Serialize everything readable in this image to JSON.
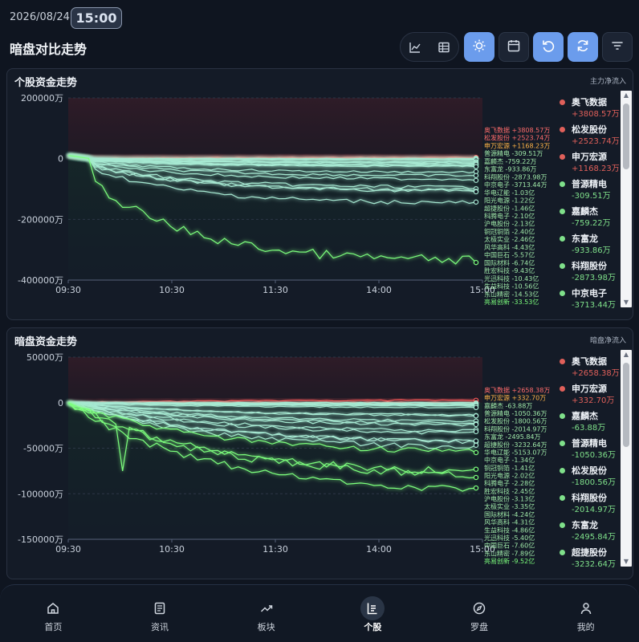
{
  "header": {
    "date": "2026/08/24",
    "time": "15:00",
    "title": "暗盘对比走势"
  },
  "toolbar": {
    "icons": [
      "line-chart-icon",
      "table-icon",
      "sun-icon",
      "calendar-icon",
      "undo-icon",
      "refresh-icon",
      "filter-icon"
    ]
  },
  "colors": {
    "red": "#e0605a",
    "green": "#7fe08a",
    "blue": "#6b9cec",
    "bg": "#0f1520"
  },
  "panel1": {
    "title": "个股资金走势",
    "subtitle": "主力净流入",
    "legend": [
      {
        "name": "奥飞数据",
        "value": "+3808.57万",
        "color": "#e0605a"
      },
      {
        "name": "松发股份",
        "value": "+2523.74万",
        "color": "#e0605a"
      },
      {
        "name": "申万宏源",
        "value": "+1168.23万",
        "color": "#e0605a"
      },
      {
        "name": "普源精电",
        "value": "-309.51万",
        "color": "#7fe08a"
      },
      {
        "name": "嘉麟杰",
        "value": "-759.22万",
        "color": "#7fe08a"
      },
      {
        "name": "东富龙",
        "value": "-933.86万",
        "color": "#7fe08a"
      },
      {
        "name": "科翔股份",
        "value": "-2873.98万",
        "color": "#7fe08a"
      },
      {
        "name": "中京电子",
        "value": "-3713.44万",
        "color": "#7fe08a"
      }
    ]
  },
  "panel2": {
    "title": "暗盘资金走势",
    "subtitle": "暗盘净流入",
    "legend": [
      {
        "name": "奥飞数据",
        "value": "+2658.38万",
        "color": "#e0605a"
      },
      {
        "name": "申万宏源",
        "value": "+332.70万",
        "color": "#e0605a"
      },
      {
        "name": "嘉麟杰",
        "value": "-63.88万",
        "color": "#7fe08a"
      },
      {
        "name": "普源精电",
        "value": "-1050.36万",
        "color": "#7fe08a"
      },
      {
        "name": "松发股份",
        "value": "-1800.56万",
        "color": "#7fe08a"
      },
      {
        "name": "科翔股份",
        "value": "-2014.97万",
        "color": "#7fe08a"
      },
      {
        "name": "东富龙",
        "value": "-2495.84万",
        "color": "#7fe08a"
      },
      {
        "name": "超捷股份",
        "value": "-3232.64万",
        "color": "#7fe08a"
      }
    ]
  },
  "chart_data": [
    {
      "type": "line",
      "title": "个股资金走势",
      "x_ticks": [
        "09:30",
        "10:30",
        "11:30",
        "14:00",
        "15:00"
      ],
      "y_ticks": [
        "200000万",
        "0",
        "-200000万",
        "-400000万"
      ],
      "ylim": [
        -400000,
        200000
      ],
      "unit": "万",
      "series_labels": [
        {
          "text": "奥飞数据 +3808.57万",
          "value": 3808.57,
          "color": "#ff6b6b"
        },
        {
          "text": "松发股份 +2523.74万",
          "value": 2523.74,
          "color": "#ff6b6b"
        },
        {
          "text": "申万宏源 +1168.23万",
          "value": 1168.23,
          "color": "#ffb347"
        },
        {
          "text": "普源精电 -309.51万",
          "value": -309.51,
          "color": "#9fe8a8"
        },
        {
          "text": "嘉麟杰 -759.22万",
          "value": -759.22,
          "color": "#9fe8a8"
        },
        {
          "text": "东富龙 -933.86万",
          "value": -933.86,
          "color": "#9fe8a8"
        },
        {
          "text": "科翔股份 -2873.98万",
          "value": -2873.98,
          "color": "#9fe8a8"
        },
        {
          "text": "中京电子 -3713.44万",
          "value": -3713.44,
          "color": "#9fe8a8"
        },
        {
          "text": "华电辽能 -1.03亿",
          "value": -10300,
          "color": "#9fe8a8"
        },
        {
          "text": "阳光电源 -1.22亿",
          "value": -12200,
          "color": "#9fe8a8"
        },
        {
          "text": "超捷股份 -1.46亿",
          "value": -14600,
          "color": "#9fe8a8"
        },
        {
          "text": "科腾电子 -2.10亿",
          "value": -21000,
          "color": "#9fe8a8"
        },
        {
          "text": "沪电股份 -2.13亿",
          "value": -21300,
          "color": "#9fe8a8"
        },
        {
          "text": "铜冠铜箔 -2.40亿",
          "value": -24000,
          "color": "#9fe8a8"
        },
        {
          "text": "太极实业 -2.46亿",
          "value": -24600,
          "color": "#9fe8a8"
        },
        {
          "text": "风华高科 -4.43亿",
          "value": -44300,
          "color": "#9fe8a8"
        },
        {
          "text": "中国巨石 -5.57亿",
          "value": -55700,
          "color": "#9fe8a8"
        },
        {
          "text": "国际材料 -6.74亿",
          "value": -67400,
          "color": "#9fe8a8"
        },
        {
          "text": "胜宏科技 -9.43亿",
          "value": -94300,
          "color": "#9fe8a8"
        },
        {
          "text": "光迅科技 -10.43亿",
          "value": -104300,
          "color": "#9fe8a8"
        },
        {
          "text": "生益科技 -10.56亿",
          "value": -105600,
          "color": "#9fe8a8"
        },
        {
          "text": "东山精密 -14.53亿",
          "value": -145300,
          "color": "#9fe8a8"
        },
        {
          "text": "亮易创新 -33.53亿",
          "value": -335300,
          "color": "#7dff7d"
        }
      ]
    },
    {
      "type": "line",
      "title": "暗盘资金走势",
      "x_ticks": [
        "09:30",
        "10:30",
        "11:30",
        "14:00",
        "15:00"
      ],
      "y_ticks": [
        "50000万",
        "0",
        "-50000万",
        "-100000万",
        "-150000万"
      ],
      "ylim": [
        -150000,
        50000
      ],
      "unit": "万",
      "series_labels": [
        {
          "text": "奥飞数据 +2658.38万",
          "value": 2658.38,
          "color": "#ff6b6b"
        },
        {
          "text": "申万宏源 +332.70万",
          "value": 332.7,
          "color": "#ffb347"
        },
        {
          "text": "嘉麟杰 -63.88万",
          "value": -63.88,
          "color": "#9fe8a8"
        },
        {
          "text": "普源精电 -1050.36万",
          "value": -1050.36,
          "color": "#9fe8a8"
        },
        {
          "text": "松发股份 -1800.56万",
          "value": -1800.56,
          "color": "#9fe8a8"
        },
        {
          "text": "科翔股份 -2014.97万",
          "value": -2014.97,
          "color": "#9fe8a8"
        },
        {
          "text": "东富龙 -2495.84万",
          "value": -2495.84,
          "color": "#9fe8a8"
        },
        {
          "text": "超捷股份 -3232.64万",
          "value": -3232.64,
          "color": "#9fe8a8"
        },
        {
          "text": "华电辽能 -5153.07万",
          "value": -5153.07,
          "color": "#9fe8a8"
        },
        {
          "text": "中京电子 -1.34亿",
          "value": -13400,
          "color": "#9fe8a8"
        },
        {
          "text": "铜冠铜箔 -1.41亿",
          "value": -14100,
          "color": "#9fe8a8"
        },
        {
          "text": "阳光电源 -2.02亿",
          "value": -20200,
          "color": "#9fe8a8"
        },
        {
          "text": "科腾电子 -2.28亿",
          "value": -22800,
          "color": "#9fe8a8"
        },
        {
          "text": "胜宏科技 -2.45亿",
          "value": -24500,
          "color": "#9fe8a8"
        },
        {
          "text": "沪电股份 -3.13亿",
          "value": -31300,
          "color": "#9fe8a8"
        },
        {
          "text": "太极实业 -3.35亿",
          "value": -33500,
          "color": "#9fe8a8"
        },
        {
          "text": "国际材料 -4.24亿",
          "value": -42400,
          "color": "#9fe8a8"
        },
        {
          "text": "风华高科 -4.31亿",
          "value": -43100,
          "color": "#9fe8a8"
        },
        {
          "text": "生益科技 -4.86亿",
          "value": -48600,
          "color": "#9fe8a8"
        },
        {
          "text": "光迅科技 -5.40亿",
          "value": -54000,
          "color": "#9fe8a8"
        },
        {
          "text": "中国巨石 -7.60亿",
          "value": -76000,
          "color": "#9fe8a8"
        },
        {
          "text": "东山精密 -7.89亿",
          "value": -78900,
          "color": "#9fe8a8"
        },
        {
          "text": "亮易创新 -9.52亿",
          "value": -95200,
          "color": "#7dff7d"
        }
      ]
    }
  ],
  "nav": [
    {
      "label": "首页",
      "icon": "home-icon",
      "active": false
    },
    {
      "label": "资讯",
      "icon": "news-icon",
      "active": false
    },
    {
      "label": "板块",
      "icon": "trend-icon",
      "active": false
    },
    {
      "label": "个股",
      "icon": "stock-icon",
      "active": true
    },
    {
      "label": "罗盘",
      "icon": "compass-icon",
      "active": false
    },
    {
      "label": "我的",
      "icon": "user-icon",
      "active": false
    }
  ]
}
